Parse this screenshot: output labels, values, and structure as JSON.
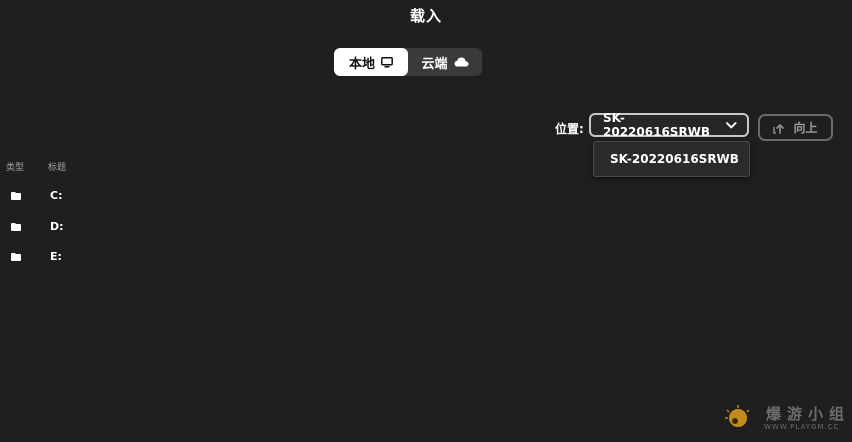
{
  "dialog": {
    "title": "载入"
  },
  "source_tabs": [
    {
      "label": "本地",
      "icon": "monitor-icon",
      "active": true
    },
    {
      "label": "云端",
      "icon": "cloud-icon",
      "active": false
    }
  ],
  "location": {
    "label": "位置:",
    "selected": "SK-20220616SRWB",
    "options": [
      "SK-20220616SRWB"
    ]
  },
  "up_button": {
    "label": "向上",
    "icon": "upload-arrow-icon"
  },
  "file_list": {
    "headers": {
      "type": "类型",
      "title": "标题"
    },
    "rows": [
      {
        "type_icon": "folder-icon",
        "name": "C:"
      },
      {
        "type_icon": "folder-icon",
        "name": "D:"
      },
      {
        "type_icon": "folder-icon",
        "name": "E:"
      }
    ]
  },
  "watermark": {
    "text": "爆游小组",
    "url": "WWW.PLAYGM.CC"
  },
  "colors": {
    "background": "#1f1f1f",
    "text": "#ffffff",
    "muted": "#a0a0a0"
  }
}
